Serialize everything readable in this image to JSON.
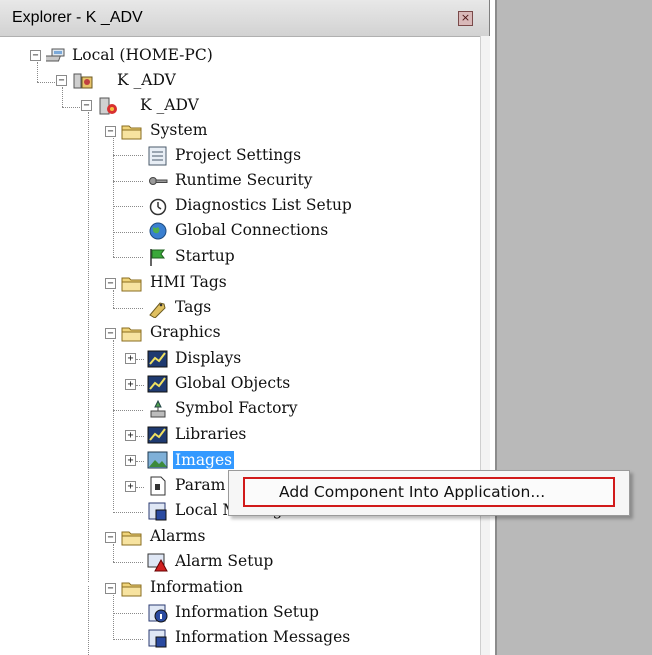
{
  "window": {
    "title": "Explorer -  K _ADV",
    "close_glyph": "×"
  },
  "tree": {
    "root": {
      "label": "Local (HOME-PC)",
      "icon": "computer-icon"
    },
    "app": {
      "label": "K _ADV",
      "icon": "application-icon"
    },
    "server": {
      "label": "K _ADV",
      "icon": "hmi-server-icon"
    },
    "system": {
      "label": "System",
      "icon": "folder-icon",
      "children": [
        {
          "label": "Project Settings",
          "icon": "project-settings-icon"
        },
        {
          "label": "Runtime Security",
          "icon": "key-icon"
        },
        {
          "label": "Diagnostics List Setup",
          "icon": "stopwatch-icon"
        },
        {
          "label": "Global Connections",
          "icon": "globe-icon"
        },
        {
          "label": "Startup",
          "icon": "startup-flag-icon"
        }
      ]
    },
    "hmi_tags": {
      "label": "HMI Tags",
      "icon": "folder-icon",
      "children": [
        {
          "label": "Tags",
          "icon": "tag-icon"
        }
      ]
    },
    "graphics": {
      "label": "Graphics",
      "icon": "folder-icon",
      "children": [
        {
          "label": "Displays",
          "icon": "display-icon"
        },
        {
          "label": "Global Objects",
          "icon": "display-icon"
        },
        {
          "label": "Symbol Factory",
          "icon": "symbol-factory-icon"
        },
        {
          "label": "Libraries",
          "icon": "display-icon"
        },
        {
          "label": "Images",
          "icon": "image-icon",
          "selected": true
        },
        {
          "label": "Param",
          "icon": "document-icon"
        },
        {
          "label": "Local Messages",
          "icon": "messages-icon"
        }
      ]
    },
    "alarms": {
      "label": "Alarms",
      "icon": "folder-icon",
      "children": [
        {
          "label": "Alarm Setup",
          "icon": "alarm-icon"
        }
      ]
    },
    "information": {
      "label": "Information",
      "icon": "folder-icon",
      "children": [
        {
          "label": "Information Setup",
          "icon": "information-icon"
        },
        {
          "label": "Information Messages",
          "icon": "messages-icon"
        }
      ]
    },
    "expander_open": "−",
    "expander_closed": "+"
  },
  "context_menu": {
    "item": "Add Component Into Application...",
    "highlight_color": "#d11a1a"
  },
  "colors": {
    "selection": "#3399ff",
    "side_panel": "#b9b9b9"
  }
}
